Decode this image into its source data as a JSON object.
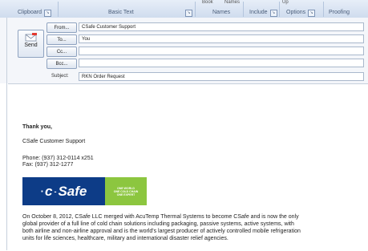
{
  "ribbon": {
    "top_labels": [
      "Book",
      "Names",
      "Up"
    ],
    "groups": [
      "Clipboard",
      "Basic Text",
      "Names",
      "Include",
      "Options",
      "Proofing"
    ]
  },
  "header": {
    "send_label": "Send",
    "from_button": "From...",
    "from_value": "CSafe Customer Support",
    "to_button": "To...",
    "to_value": "You",
    "cc_button": "Cc...",
    "cc_value": "",
    "bcc_button": "Bcc...",
    "bcc_value": "",
    "subject_label": "Subject:",
    "subject_value": "RKN Order Request"
  },
  "body": {
    "thanks": "Thank you,",
    "company_support": "CSafe Customer Support",
    "phone": "Phone: (937) 312-0114  x251",
    "fax": "Fax:  (937) 312-1277",
    "logo_text": "Safe",
    "logo_tagline": [
      "ONE WORLD",
      "ONE COLD CHAIN",
      "ONE EXPERT"
    ],
    "paragraph_lines": [
      "On October 8, 2012, CSafe LLC merged with AcuTemp Thermal Systems to become CSafe and is now the only",
      "global provider of a full line of cold chain solutions including packaging, passive systems, active systems, with",
      "both airline and non-airline approval and is the world's largest producer of actively controlled mobile refrigeration",
      "units for life sciences, healthcare, military and international disaster relief agencies."
    ]
  },
  "colors": {
    "logo_blue": "#0d3c87",
    "logo_green": "#8cc63f"
  }
}
